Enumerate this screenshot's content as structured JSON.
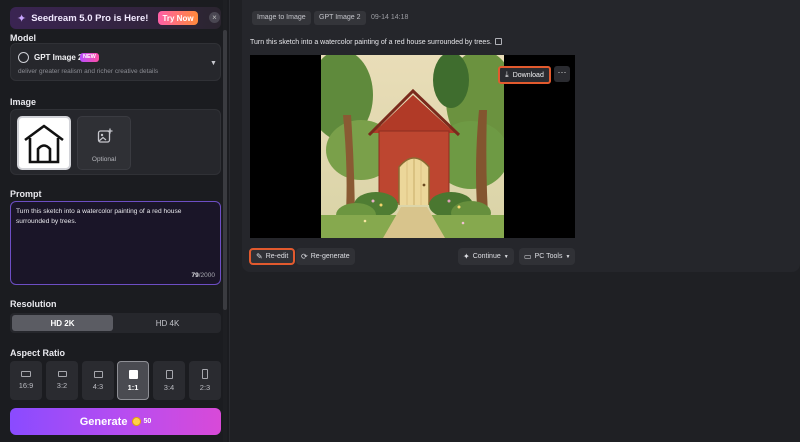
{
  "promo": {
    "text": "Seedream 5.0 Pro is Here!",
    "cta": "Try Now",
    "close": "×"
  },
  "model": {
    "section_label": "Model",
    "name": "GPT Image 2",
    "badge": "NEW",
    "description": "deliver greater realism and richer creative details"
  },
  "image": {
    "section_label": "Image",
    "optional_label": "Optional"
  },
  "prompt": {
    "section_label": "Prompt",
    "text": "Turn this sketch into a watercolor painting of a red house surrounded by trees.",
    "count": "79",
    "max": "/2000"
  },
  "resolution": {
    "section_label": "Resolution",
    "options": [
      {
        "label": "HD 2K",
        "selected": true
      },
      {
        "label": "HD 4K",
        "selected": false
      }
    ]
  },
  "aspect_ratio": {
    "section_label": "Aspect Ratio",
    "options": [
      {
        "label": "16:9",
        "selected": false
      },
      {
        "label": "3:2",
        "selected": false
      },
      {
        "label": "4:3",
        "selected": false
      },
      {
        "label": "1:1",
        "selected": true
      },
      {
        "label": "3:4",
        "selected": false
      },
      {
        "label": "2:3",
        "selected": false
      }
    ]
  },
  "generate": {
    "label": "Generate",
    "cost": "50"
  },
  "result": {
    "tags": [
      "Image to Image",
      "GPT Image 2"
    ],
    "timestamp": "09-14 14:18",
    "prompt": "Turn this sketch into a watercolor painting of a red house surrounded by trees.",
    "download_label": "Download",
    "more_label": "···",
    "actions": {
      "reedit": "Re-edit",
      "regenerate": "Re-generate",
      "continue": "Continue",
      "pc_tools": "PC Tools"
    }
  },
  "colors": {
    "accent_purple": "#8a4bff",
    "highlight_orange": "#e25a2e",
    "house_red": "#b8402a"
  }
}
